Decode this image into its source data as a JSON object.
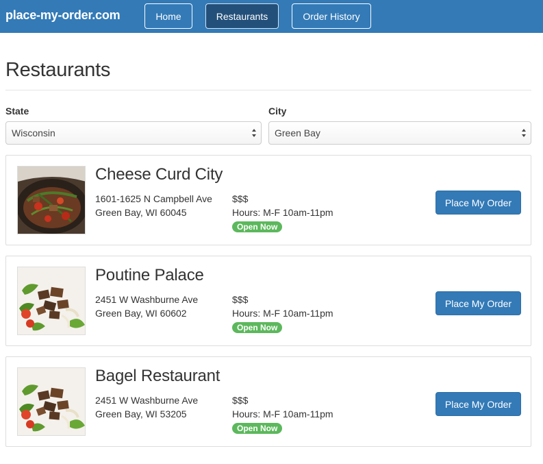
{
  "header": {
    "brand": "place-my-order.com",
    "nav": [
      {
        "label": "Home",
        "active": false
      },
      {
        "label": "Restaurants",
        "active": true
      },
      {
        "label": "Order History",
        "active": false
      }
    ]
  },
  "page": {
    "title": "Restaurants"
  },
  "filters": {
    "state": {
      "label": "State",
      "value": "Wisconsin"
    },
    "city": {
      "label": "City",
      "value": "Green Bay"
    }
  },
  "restaurants": [
    {
      "name": "Cheese Curd City",
      "address_line1": "1601-1625 N Campbell Ave",
      "address_line2": "Green Bay, WI 60045",
      "price": "$$$",
      "hours": "Hours: M-F 10am-11pm",
      "status": "Open Now",
      "action": "Place My Order",
      "image_icon": "stir-fry-dish-photo"
    },
    {
      "name": "Poutine Palace",
      "address_line1": "2451 W Washburne Ave",
      "address_line2": "Green Bay, WI 60602",
      "price": "$$$",
      "hours": "Hours: M-F 10am-11pm",
      "status": "Open Now",
      "action": "Place My Order",
      "image_icon": "steak-salad-photo"
    },
    {
      "name": "Bagel Restaurant",
      "address_line1": "2451 W Washburne Ave",
      "address_line2": "Green Bay, WI 53205",
      "price": "$$$",
      "hours": "Hours: M-F 10am-11pm",
      "status": "Open Now",
      "action": "Place My Order",
      "image_icon": "steak-salad-photo"
    }
  ],
  "colors": {
    "navbar": "#337ab7",
    "nav_active": "#23507a",
    "primary_button": "#337ab7",
    "open_badge": "#5cb85c"
  }
}
